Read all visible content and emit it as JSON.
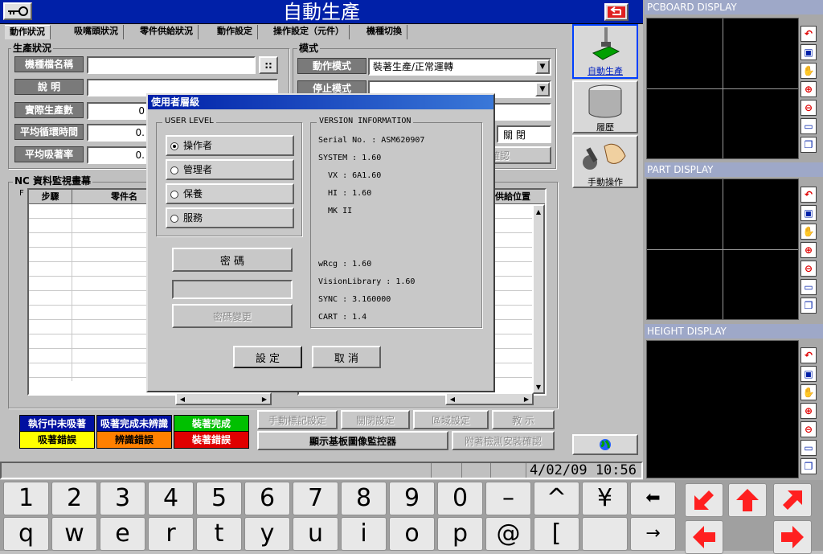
{
  "app": {
    "title": "自動生產"
  },
  "tabs": [
    "動作狀況",
    "吸嘴頭狀況",
    "零件供給狀況",
    "動作設定",
    "操作設定（元件）",
    "機種切換"
  ],
  "production": {
    "section": "生產狀況",
    "model_label": "機種檔名稱",
    "model_button": "::",
    "desc_label": "說 明",
    "actual_label": "實際生產數",
    "actual_value": "0",
    "cycle_label": "平均循環時間",
    "cycle_value": "0.",
    "pickup_label": "平均吸著率",
    "pickup_value": "0."
  },
  "mode": {
    "section": "模式",
    "run_label": "動作模式",
    "run_value": "裝著生產/正常運轉",
    "stop_label": "停止模式",
    "close_label": "關 閉",
    "confirm_label": "確認"
  },
  "nc": {
    "section": "NC 資料監視畫幕",
    "columns": [
      "步驟",
      "零件名"
    ],
    "right_columns": [
      "供給位置"
    ],
    "f_label": "F"
  },
  "status_legend": [
    {
      "label": "執行中未吸著",
      "bg": "#0010a0",
      "fg": "#ffffff"
    },
    {
      "label": "吸著完成未辨識",
      "bg": "#0010a0",
      "fg": "#ffffff"
    },
    {
      "label": "裝著完成",
      "bg": "#00c000",
      "fg": "#ffffff"
    },
    {
      "label": "吸著錯誤",
      "bg": "#ffff00",
      "fg": "#000000"
    },
    {
      "label": "辨識錯誤",
      "bg": "#ff8000",
      "fg": "#000000"
    },
    {
      "label": "裝著錯誤",
      "bg": "#e00000",
      "fg": "#ffffff"
    }
  ],
  "bottom_buttons": {
    "manual_mark": "手動標記設定",
    "valve": "關閉設定",
    "region": "區域設定",
    "teach": "教 示",
    "image_monitor": "顯示基板圖像監控器",
    "attach_check": "附著檢測安裝確認"
  },
  "datetime": "4/02/09 10:56",
  "side_buttons": {
    "auto": "自動生產",
    "history": "履歷",
    "manual": "手動操作"
  },
  "displays": [
    "PCBOARD DISPLAY",
    "PART DISPLAY",
    "HEIGHT DISPLAY"
  ],
  "display_icons": [
    "undo-icon",
    "zoom-window-icon",
    "hand-icon",
    "zoom-in-icon",
    "zoom-out-icon",
    "fit-icon",
    "copy-icon"
  ],
  "dialog": {
    "title": "使用者層級",
    "user_level_legend": "USER LEVEL",
    "levels": [
      "操作者",
      "管理者",
      "保養",
      "服務"
    ],
    "selected_level": 0,
    "password_label": "密 碼",
    "password_value": "",
    "change_password": "密碼變更",
    "version_legend": "VERSION INFORMATION",
    "version_lines": [
      "Serial No. : ASM620907",
      "SYSTEM : 1.60",
      "  VX : 6A1.60",
      "  HI : 1.60",
      "  MK II",
      "",
      "",
      "wRcg : 1.60",
      "VisionLibrary : 1.60",
      "SYNC : 3.160000",
      "CART : 1.4"
    ],
    "ok": "設 定",
    "cancel": "取 消"
  },
  "keyboard": {
    "row1": [
      "1",
      "2",
      "3",
      "4",
      "5",
      "6",
      "7",
      "8",
      "9",
      "0",
      "–",
      "^",
      "¥",
      "⬅"
    ],
    "row2": [
      "q",
      "w",
      "e",
      "r",
      "t",
      "y",
      "u",
      "i",
      "o",
      "p",
      "@",
      "[",
      "",
      "→"
    ]
  }
}
